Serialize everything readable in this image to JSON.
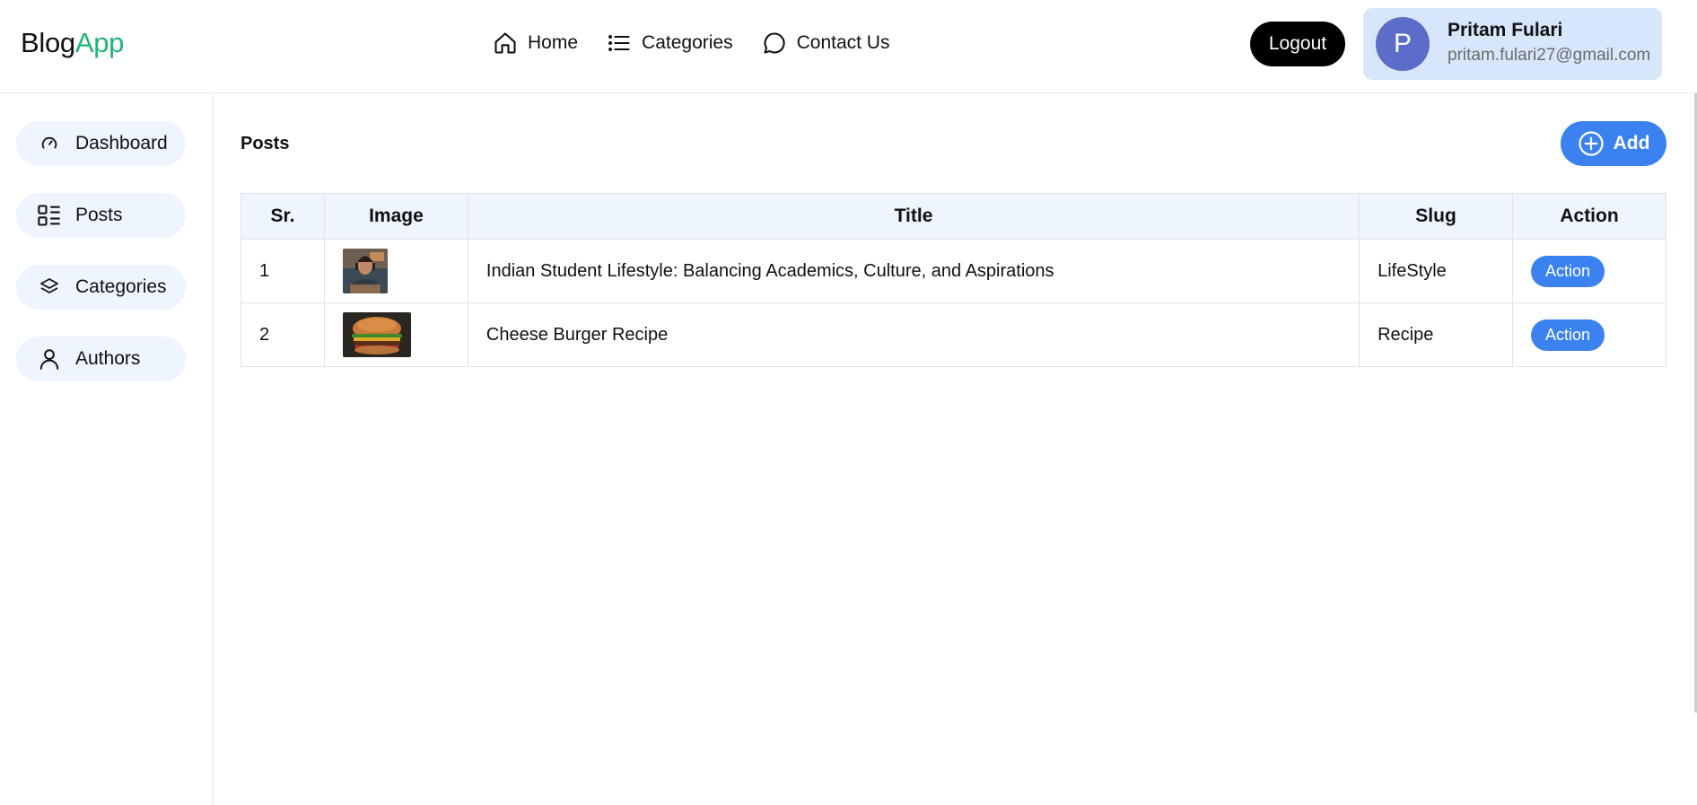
{
  "brand": {
    "part1": "Blog",
    "part2": "App",
    "accent": "#22b573"
  },
  "nav": [
    {
      "label": "Home",
      "icon": "home-icon"
    },
    {
      "label": "Categories",
      "icon": "list-icon"
    },
    {
      "label": "Contact Us",
      "icon": "chat-bubble-icon"
    }
  ],
  "header": {
    "logout_label": "Logout"
  },
  "user": {
    "initial": "P",
    "name": "Pritam Fulari",
    "email": "pritam.fulari27@gmail.com"
  },
  "sidebar": {
    "items": [
      {
        "label": "Dashboard",
        "icon": "gauge-icon"
      },
      {
        "label": "Posts",
        "icon": "grid-list-icon"
      },
      {
        "label": "Categories",
        "icon": "layers-icon"
      },
      {
        "label": "Authors",
        "icon": "user-icon"
      }
    ]
  },
  "main": {
    "title": "Posts",
    "add_label": "Add",
    "columns": [
      "Sr.",
      "Image",
      "Title",
      "Slug",
      "Action"
    ],
    "rows": [
      {
        "sr": "1",
        "image": "student-photo",
        "title": "Indian Student Lifestyle: Balancing Academics, Culture, and Aspirations",
        "slug": "LifeStyle",
        "action": "Action"
      },
      {
        "sr": "2",
        "image": "burger-photo",
        "title": "Cheese Burger Recipe",
        "slug": "Recipe",
        "action": "Action"
      }
    ]
  },
  "colors": {
    "primary": "#3b82f0",
    "sidebar_bg": "#eef5ff",
    "profile_bg": "#d8e6fb",
    "avatar": "#5b6cc9"
  }
}
